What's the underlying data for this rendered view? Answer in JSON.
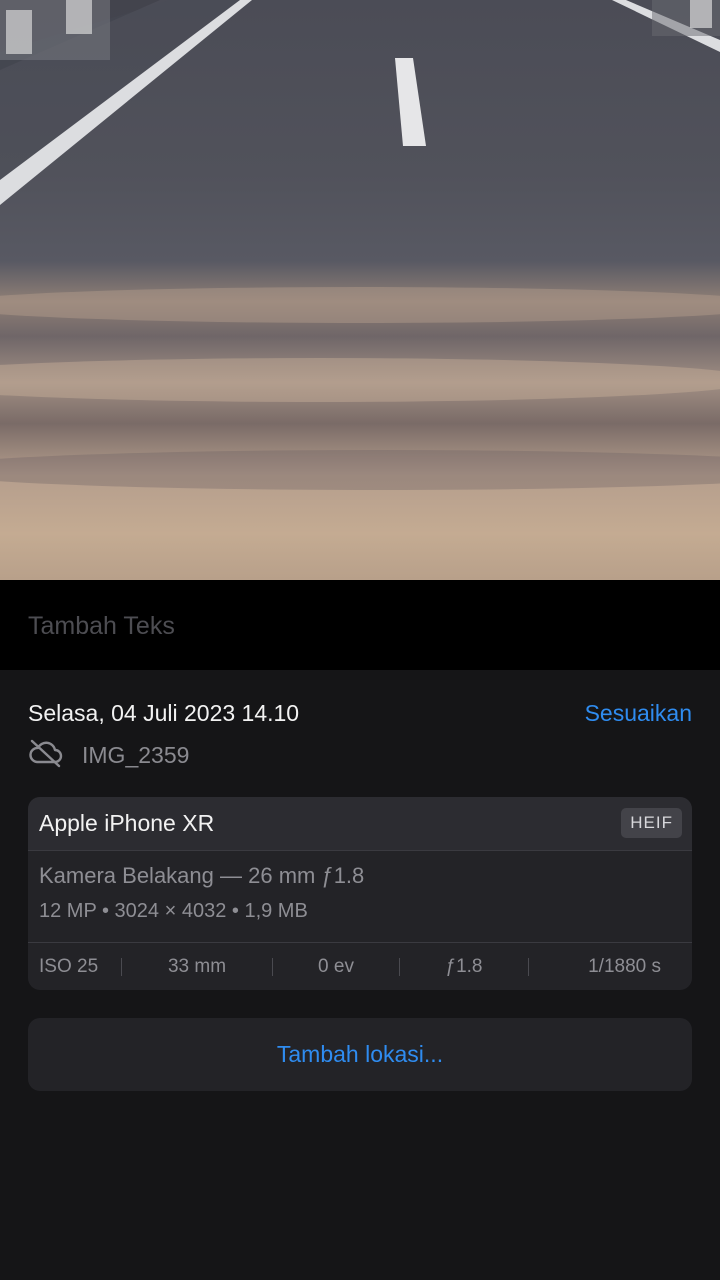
{
  "photo": {
    "description_icon": "road-photo"
  },
  "caption": {
    "placeholder": "Tambah Teks"
  },
  "info": {
    "date": "Selasa, 04 Juli 2023 14.10",
    "adjust_label": "Sesuaikan",
    "file_icon": "cloud-slash-icon",
    "file_name": "IMG_2359"
  },
  "device_card": {
    "device": "Apple iPhone XR",
    "format_badge": "HEIF",
    "lens": "Kamera Belakang — 26 mm ƒ1.8",
    "specs": "12 MP  •  3024 × 4032  •  1,9 MB",
    "exif": {
      "iso": "ISO 25",
      "focal": "33 mm",
      "ev": "0 ev",
      "aperture": "ƒ1.8",
      "shutter": "1/1880 s"
    }
  },
  "location": {
    "add_label": "Tambah lokasi..."
  },
  "colors": {
    "accent": "#2f8cf0",
    "background": "#151517"
  }
}
